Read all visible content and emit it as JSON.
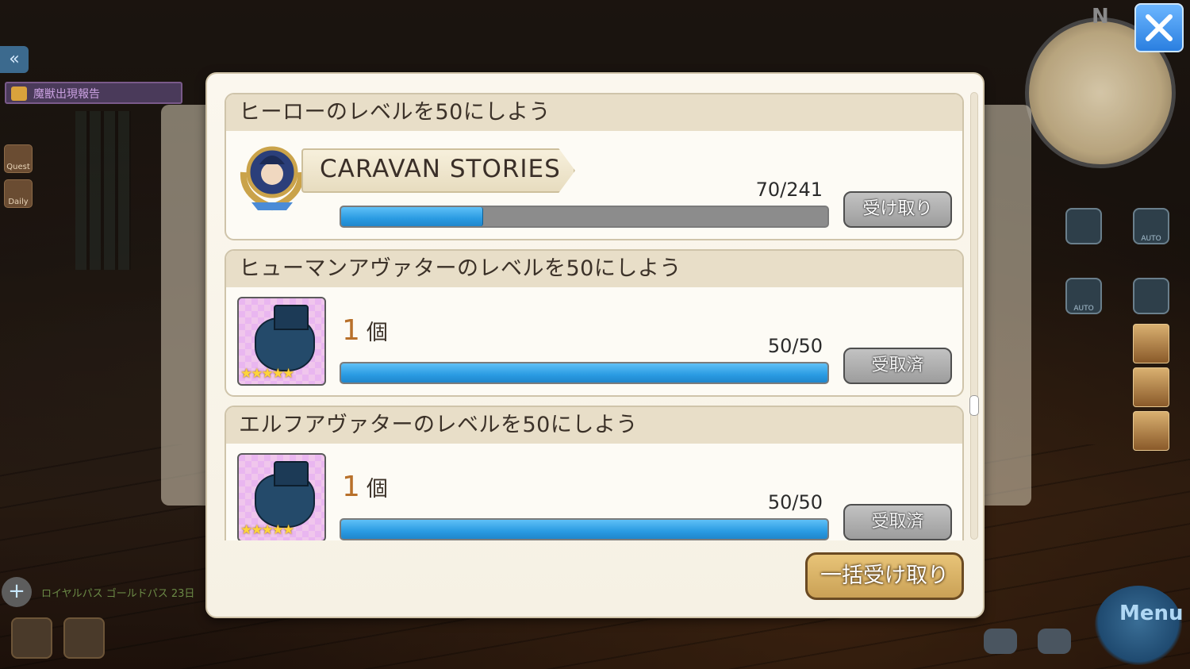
{
  "hud": {
    "notice_label": "魔獣出現報告",
    "side_quest_label": "Quest",
    "side_daily_label": "Daily",
    "bottom_banner": "ロイヤルパス ゴールドパス 23日",
    "minimap_north": "N",
    "auto_label": "AUTO",
    "menu_label": "Menu"
  },
  "missions": [
    {
      "title": "ヒーローのレベルを50にしよう",
      "reward_logo_text": "CARAVAN STORIES",
      "progress_text": "70/241",
      "progress_fraction": 0.29,
      "button_label": "受け取り",
      "button_state": "claimable"
    },
    {
      "title": "ヒューマンアヴァターのレベルを50にしよう",
      "reward_qty": "1",
      "reward_unit": "個",
      "reward_stars": "★★★★★",
      "progress_text": "50/50",
      "progress_fraction": 1.0,
      "button_label": "受取済",
      "button_state": "claimed"
    },
    {
      "title": "エルフアヴァターのレベルを50にしよう",
      "reward_qty": "1",
      "reward_unit": "個",
      "reward_stars": "★★★★★",
      "progress_text": "50/50",
      "progress_fraction": 1.0,
      "button_label": "受取済",
      "button_state": "claimed"
    }
  ],
  "claim_all_label": "一括受け取り",
  "colors": {
    "progress_fill": "#2a9be2",
    "close_button": "#2a7fe0",
    "claim_all": "#caa156"
  },
  "icons": {
    "close": "close-x-icon",
    "back": "double-chevron-left-icon",
    "reward_item": "treasure-bag-icon"
  }
}
